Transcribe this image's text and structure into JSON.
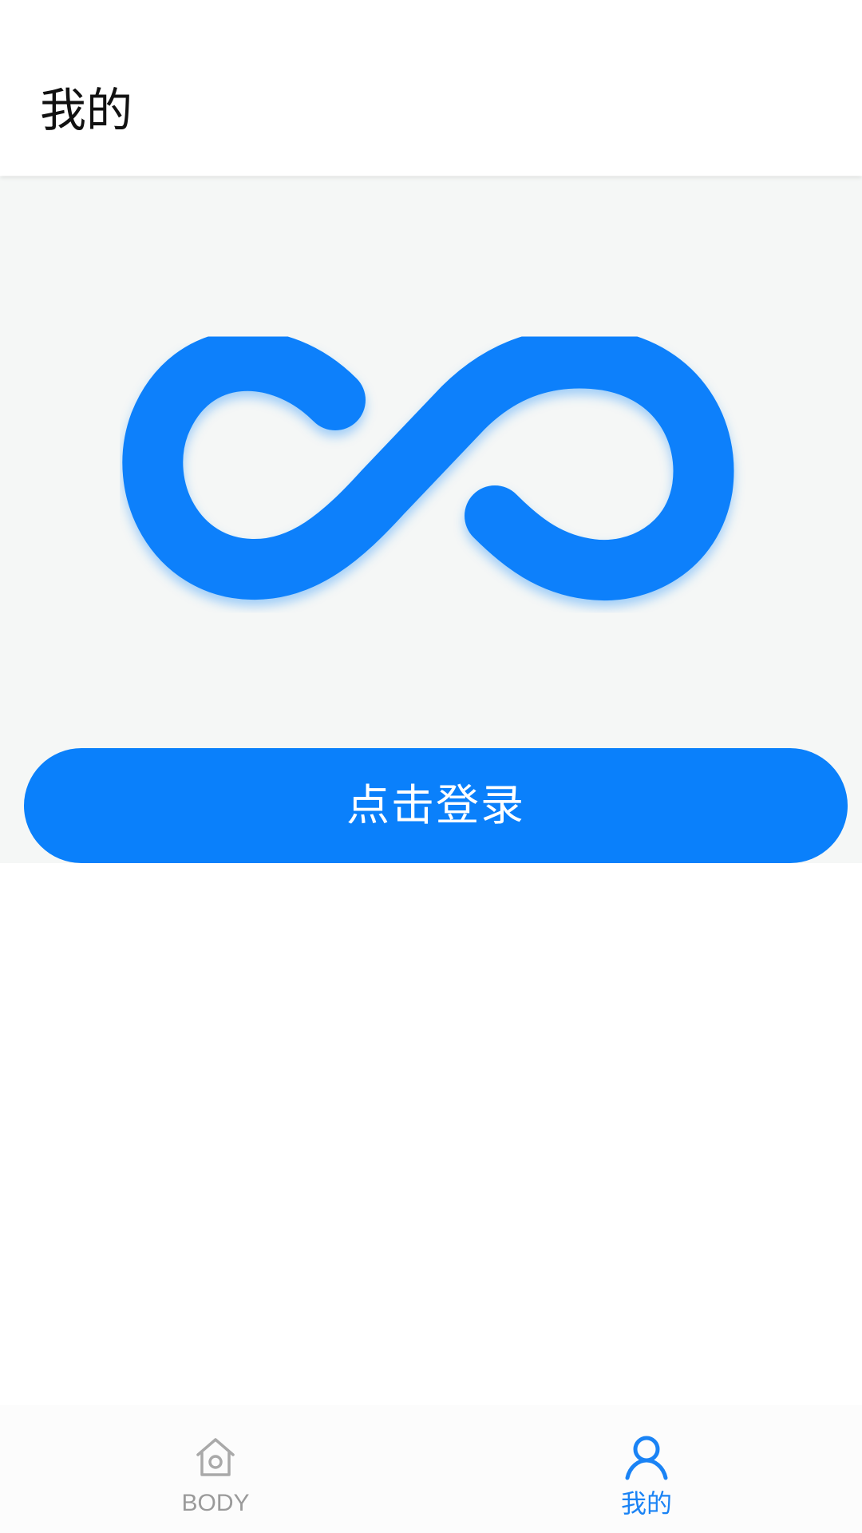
{
  "header": {
    "title": "我的"
  },
  "hero": {
    "logo_icon": "infinity-logo-icon",
    "login_button_label": "点击登录"
  },
  "tabbar": {
    "items": [
      {
        "label": "BODY",
        "icon": "home-icon",
        "active": false
      },
      {
        "label": "我的",
        "icon": "user-icon",
        "active": true
      }
    ]
  },
  "colors": {
    "accent": "#0a80fb",
    "hero_background": "#f5f7f6",
    "inactive_tab": "#9a9a9a",
    "active_tab": "#1a83f5"
  }
}
